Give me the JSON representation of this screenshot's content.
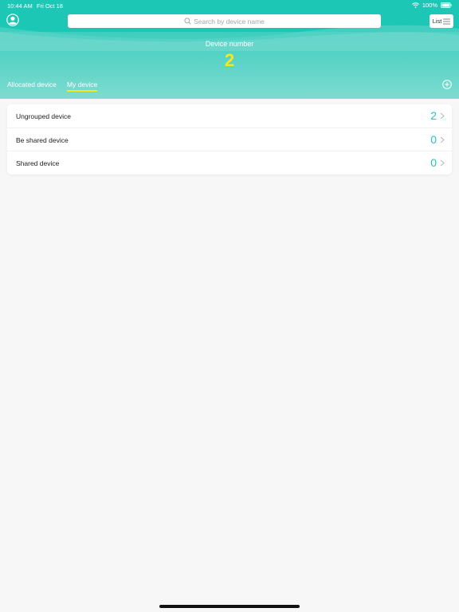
{
  "status": {
    "time": "10:44 AM",
    "date": "Fri Oct 18",
    "battery": "100%"
  },
  "search": {
    "placeholder": "Search by device name"
  },
  "view_toggle": {
    "label": "List"
  },
  "summary": {
    "label": "Device number",
    "count": "2"
  },
  "tabs": [
    {
      "label": "Allocated device",
      "active": false
    },
    {
      "label": "My device",
      "active": true
    }
  ],
  "device_groups": [
    {
      "label": "Ungrouped device",
      "count": "2"
    },
    {
      "label": "Be shared device",
      "count": "0"
    },
    {
      "label": "Shared device",
      "count": "0"
    }
  ],
  "colors": {
    "brand": "#1cc8b5",
    "accent_yellow": "#f8e71c",
    "count_teal": "#26c6b5"
  }
}
